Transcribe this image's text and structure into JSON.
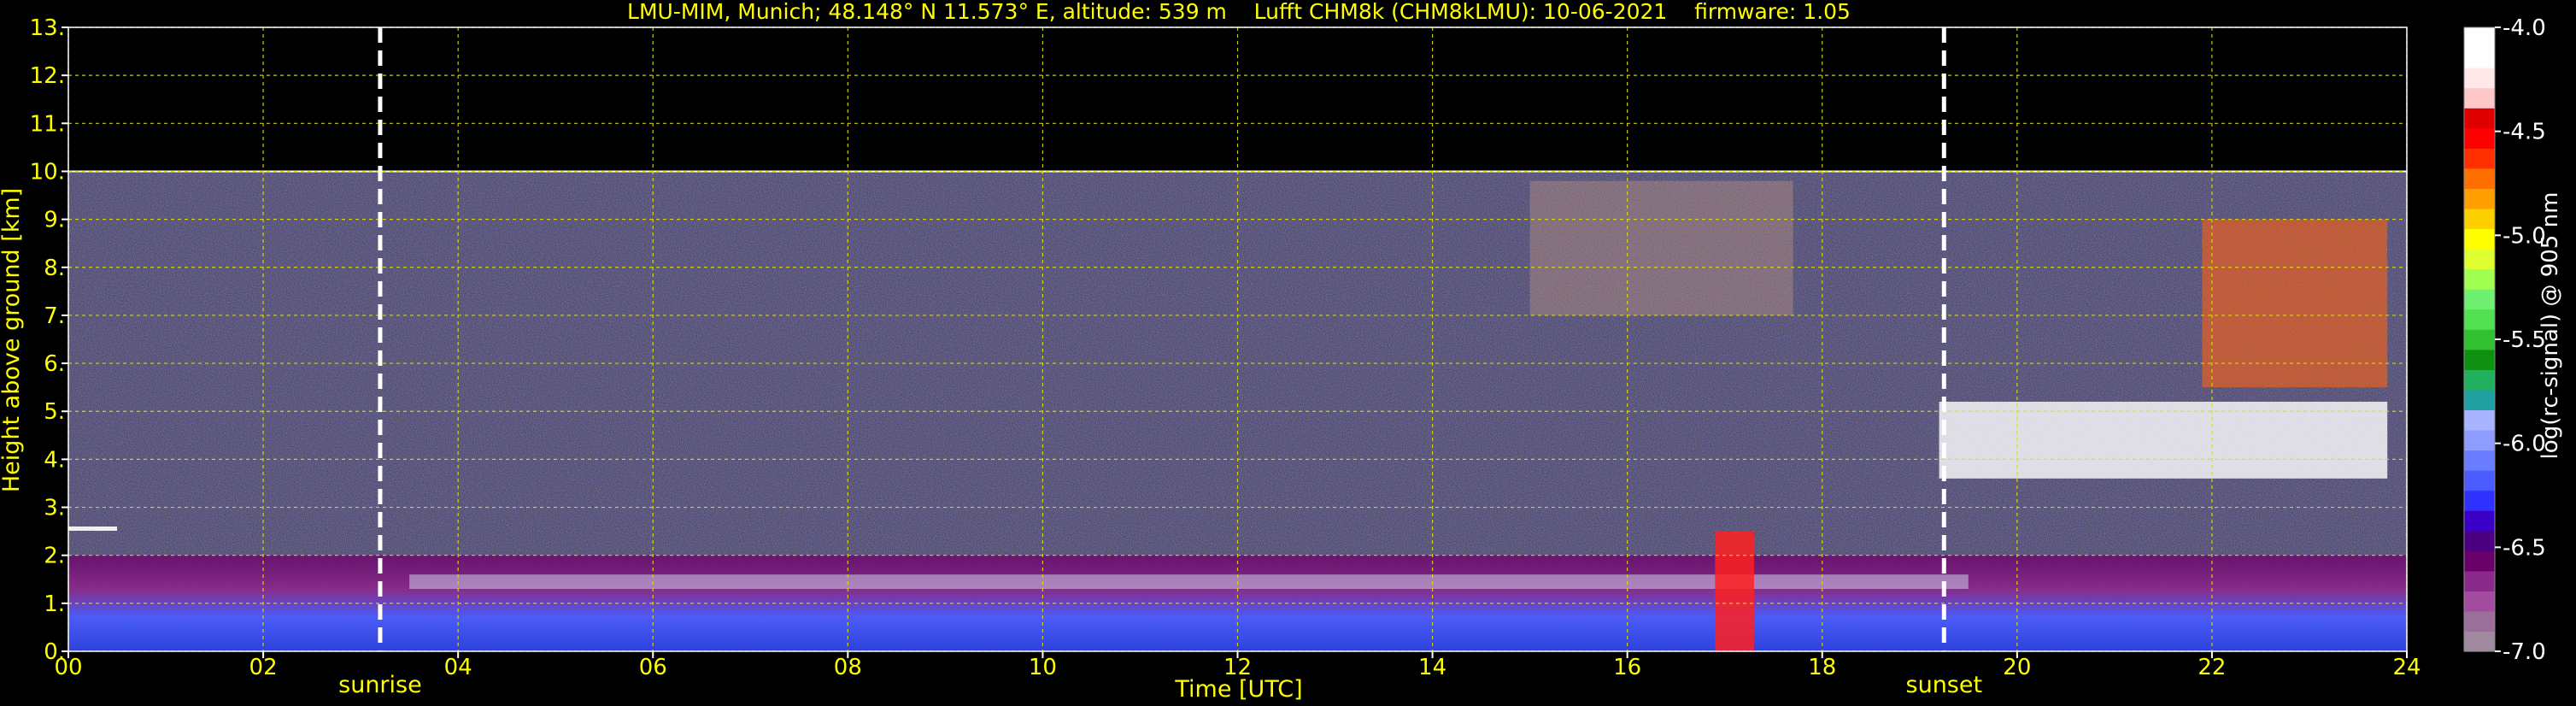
{
  "chart_data": {
    "type": "heatmap",
    "title": "LMU-MIM, Munich; 48.148° N 11.573° E, altitude: 539 m    Lufft CHM8k (CHM8kLMU): 10-06-2021    firmware: 1.05",
    "xlabel": "Time [UTC]",
    "ylabel": "Height above ground [km]",
    "xlim": [
      0,
      24
    ],
    "ylim": [
      0,
      13
    ],
    "x_ticks": [
      "00",
      "02",
      "04",
      "06",
      "08",
      "10",
      "12",
      "14",
      "16",
      "18",
      "20",
      "22",
      "24"
    ],
    "y_ticks": [
      "0.",
      "1.",
      "2.",
      "3.",
      "4.",
      "5.",
      "6.",
      "7.",
      "8.",
      "9.",
      "10.",
      "11.",
      "12.",
      "13."
    ],
    "grid": true,
    "data_top_km": 10,
    "markers": [
      {
        "label": "sunrise",
        "time": 3.2
      },
      {
        "label": "sunset",
        "time": 19.25
      }
    ],
    "colorbar": {
      "label": "log(rc-signal) @ 905 nm",
      "range": [
        -7.0,
        -4.0
      ],
      "ticks": [
        "-4.0",
        "-4.5",
        "-5.0",
        "-5.5",
        "-6.0",
        "-6.5",
        "-7.0"
      ],
      "colors": [
        "#a08aa0",
        "#9a6f9a",
        "#a24ca0",
        "#8a2a8a",
        "#6a006a",
        "#4b0082",
        "#3a00c8",
        "#3030ff",
        "#4a5cff",
        "#6a7cff",
        "#8e9cff",
        "#a8b4ff",
        "#20a0a0",
        "#20b060",
        "#109010",
        "#30c030",
        "#50e050",
        "#70f070",
        "#a0ff50",
        "#e0ff30",
        "#ffff00",
        "#ffd000",
        "#ffa000",
        "#ff7000",
        "#ff3000",
        "#ff0000",
        "#e00000",
        "#ffc8c8",
        "#ffe8e8",
        "#ffffff",
        "#ffffff"
      ]
    },
    "features": [
      {
        "name": "boundary-layer aerosol",
        "time": [
          0,
          24
        ],
        "height_km": [
          0,
          2.0
        ]
      },
      {
        "name": "residual layer top",
        "time": [
          0,
          0.5
        ],
        "height_km": [
          2.6,
          2.6
        ]
      },
      {
        "name": "boundary-layer cloud tops",
        "time": [
          3.5,
          19.5
        ],
        "height_km": [
          1.3,
          1.6
        ]
      },
      {
        "name": "precipitation column",
        "time": [
          16.9,
          17.3
        ],
        "height_km": [
          0,
          2.5
        ]
      },
      {
        "name": "mid-level cloud",
        "time": [
          19.2,
          23.8
        ],
        "height_km": [
          3.6,
          5.2
        ]
      },
      {
        "name": "high cloud",
        "time": [
          21.9,
          23.8
        ],
        "height_km": [
          5.5,
          9.0
        ]
      },
      {
        "name": "cirrus",
        "time": [
          15.0,
          17.7
        ],
        "height_km": [
          7.0,
          9.8
        ]
      }
    ]
  }
}
